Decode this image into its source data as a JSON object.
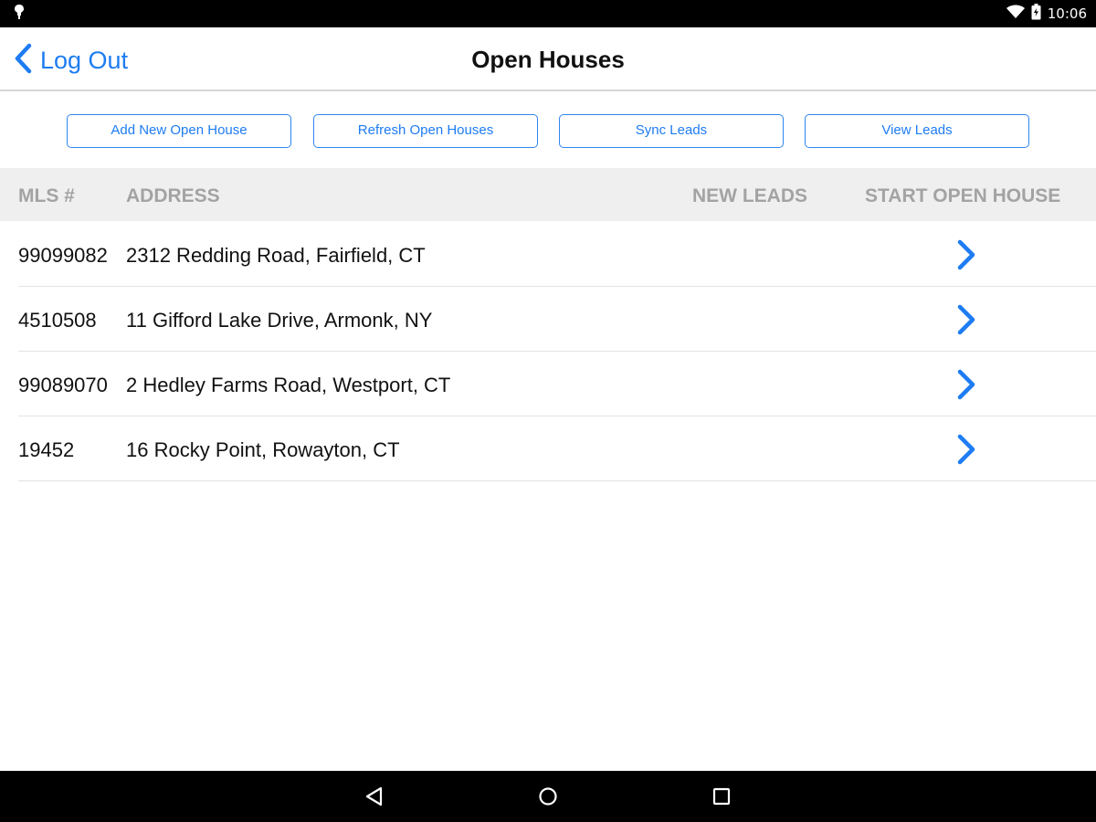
{
  "status_bar": {
    "time": "10:06",
    "icons": [
      "notification-icon",
      "wifi-icon",
      "battery-icon"
    ]
  },
  "nav": {
    "back_label": "Log Out",
    "title": "Open Houses",
    "accent_color": "#1e7cf2"
  },
  "actions": [
    {
      "label": "Add New Open House"
    },
    {
      "label": "Refresh Open Houses"
    },
    {
      "label": "Sync Leads"
    },
    {
      "label": "View Leads"
    }
  ],
  "table": {
    "headers": {
      "mls": "MLS #",
      "address": "ADDRESS",
      "new_leads": "NEW LEADS",
      "start": "START OPEN HOUSE"
    },
    "rows": [
      {
        "mls": "99099082",
        "address": "2312 Redding Road, Fairfield, CT"
      },
      {
        "mls": "4510508",
        "address": "11 Gifford Lake Drive, Armonk, NY"
      },
      {
        "mls": "99089070",
        "address": "2 Hedley Farms Road, Westport, CT"
      },
      {
        "mls": "19452",
        "address": "16 Rocky Point, Rowayton, CT"
      }
    ]
  },
  "system_nav": [
    "back-triangle-icon",
    "home-circle-icon",
    "recents-square-icon"
  ]
}
